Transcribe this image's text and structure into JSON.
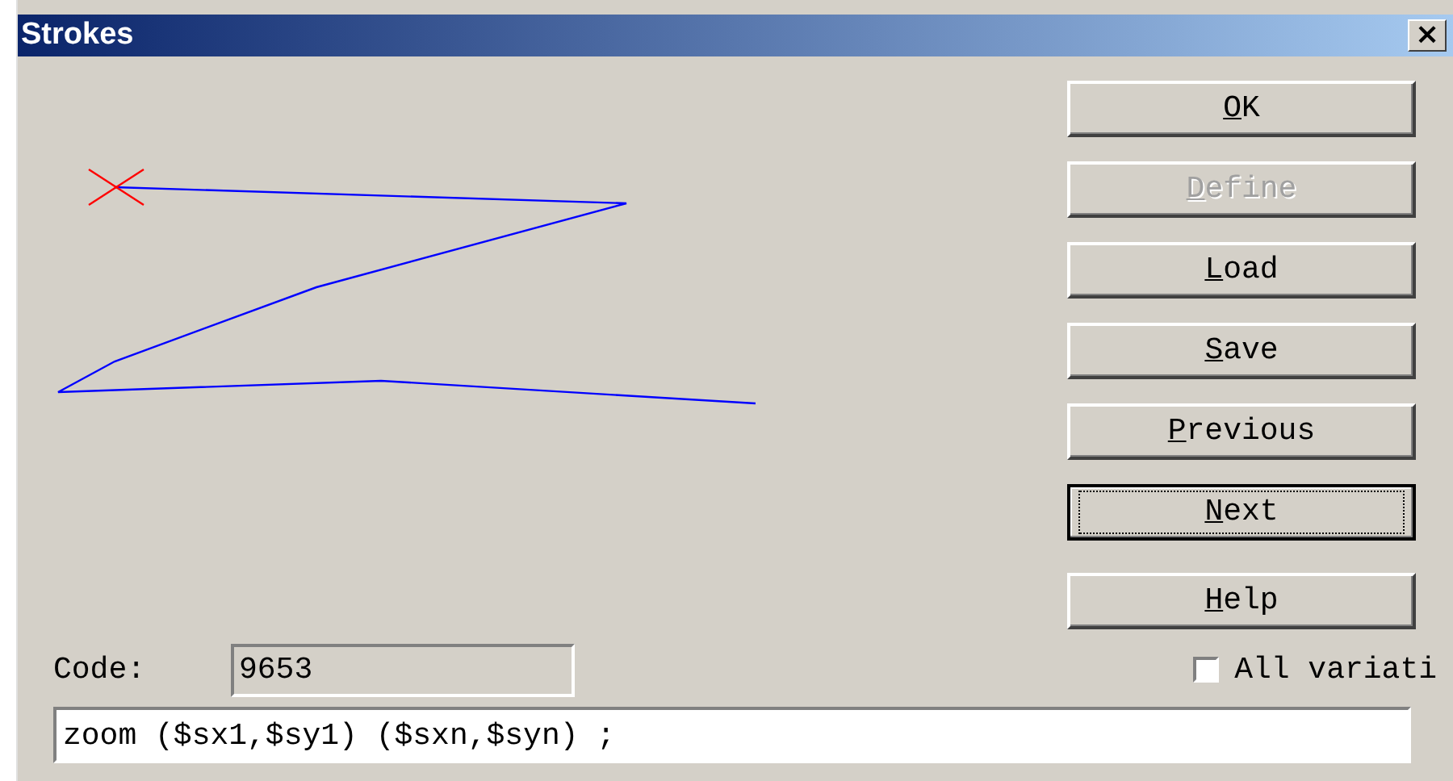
{
  "window": {
    "title": "Strokes",
    "close": "×"
  },
  "buttons": [
    {
      "mnemonic": "O",
      "rest": "K",
      "disabled": false,
      "default": false
    },
    {
      "mnemonic": "D",
      "rest": "efine",
      "disabled": true,
      "default": false
    },
    {
      "mnemonic": "L",
      "rest": "oad",
      "disabled": false,
      "default": false
    },
    {
      "mnemonic": "S",
      "rest": "ave",
      "disabled": false,
      "default": false
    },
    {
      "mnemonic": "P",
      "rest": "revious",
      "disabled": false,
      "default": false
    },
    {
      "mnemonic": "N",
      "rest": "ext",
      "disabled": false,
      "default": true
    },
    {
      "mnemonic": "H",
      "rest": "elp",
      "disabled": false,
      "default": false
    }
  ],
  "code": {
    "label": "Code:",
    "value": "9653"
  },
  "all_variations": {
    "label": "All variati",
    "checked": false
  },
  "command": {
    "value": "zoom ($sx1,$sy1) ($sxn,$syn) ;"
  }
}
